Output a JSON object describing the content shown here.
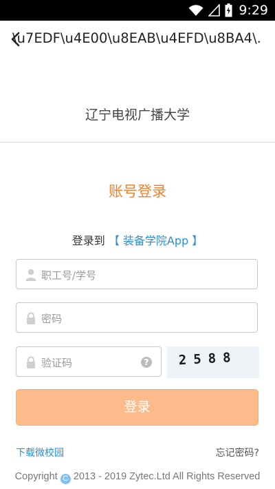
{
  "status_bar": {
    "time": "9:29"
  },
  "app_bar": {
    "title": "\\u7EDF\\u4E00\\u8EAB\\u4EFD\\u8BA4\\."
  },
  "school_name": "辽宁电视广播大学",
  "login": {
    "title": "账号登录",
    "login_to_prefix": "登录到",
    "app_name": "【 装备学院App 】",
    "username_placeholder": "职工号/学号",
    "password_placeholder": "密码",
    "captcha_placeholder": "验证码",
    "captcha_text": "2588",
    "submit_label": "登录"
  },
  "links": {
    "download": "下载微校园",
    "forgot_password": "忘记密码?"
  },
  "footer": {
    "prefix": "Copyright",
    "copy_symbol": "C",
    "text": "2013 - 2019 Zytec.Ltd All Rights Reserved"
  },
  "colors": {
    "accent_orange": "#f0812b",
    "button_bg": "#fcbb8a",
    "link_blue": "#2b8ed6"
  }
}
